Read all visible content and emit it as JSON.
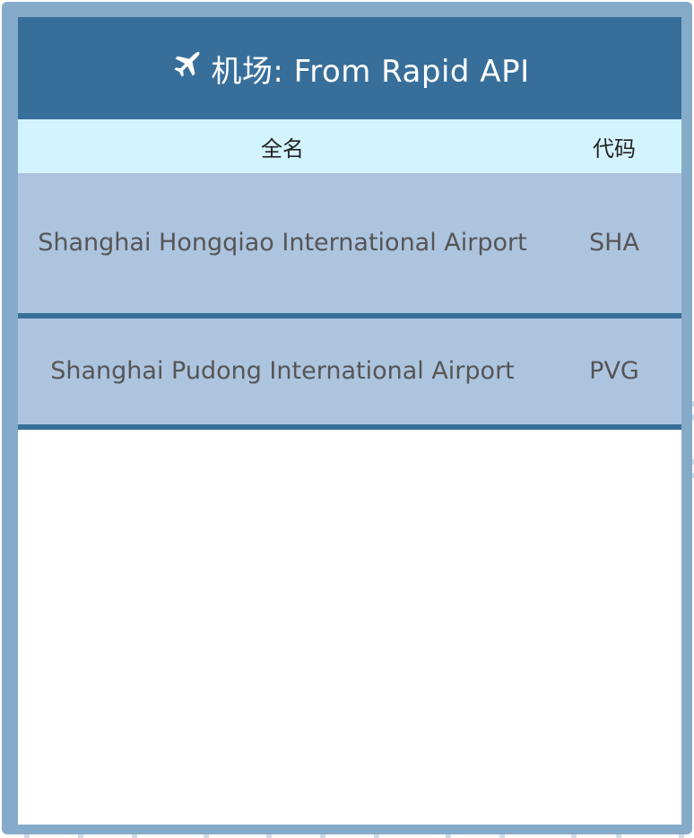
{
  "widget": {
    "title_main": "机场: From Rapid API",
    "icon": "plane-icon"
  },
  "table": {
    "headers": {
      "name": "全名",
      "code": "代码"
    },
    "rows": [
      {
        "name": "Shanghai Hongqiao International Airport",
        "code": "SHA"
      },
      {
        "name": "Shanghai Pudong International Airport",
        "code": "PVG"
      }
    ]
  },
  "colors": {
    "frame": "#86abc9",
    "title_bg": "#386f9a",
    "header_bg": "#d3f3ff",
    "row_bg": "#adc4df",
    "row_border": "#386f9a"
  }
}
